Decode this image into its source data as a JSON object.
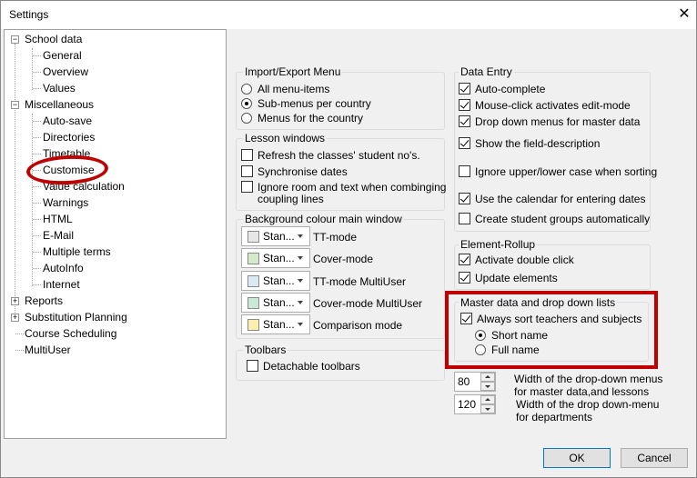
{
  "window": {
    "title": "Settings",
    "close_glyph": "✕"
  },
  "tree": {
    "school_data": {
      "label": "School data",
      "expanded": true,
      "children": [
        "General",
        "Overview",
        "Values"
      ]
    },
    "miscellaneous": {
      "label": "Miscellaneous",
      "expanded": true,
      "children": [
        "Auto-save",
        "Directories",
        "Timetable",
        "Customise",
        "Value calculation",
        "Warnings",
        "HTML",
        "E-Mail",
        "Multiple terms",
        "AutoInfo",
        "Internet"
      ]
    },
    "reports": {
      "label": "Reports"
    },
    "substitution": {
      "label": "Substitution Planning"
    },
    "course_scheduling": {
      "label": "Course Scheduling"
    },
    "multiuser": {
      "label": "MultiUser"
    },
    "highlighted_item": "Customise",
    "highlight_color": "#c00000"
  },
  "import_export": {
    "title": "Import/Export Menu",
    "options": [
      {
        "label": "All menu-items",
        "selected": false
      },
      {
        "label": "Sub-menus per country",
        "selected": true
      },
      {
        "label": "Menus for the country",
        "selected": false
      }
    ]
  },
  "lesson_windows": {
    "title": "Lesson windows",
    "items": [
      {
        "label": "Refresh the classes' student no's.",
        "checked": false
      },
      {
        "label": "Synchronise dates",
        "checked": false
      },
      {
        "label": "Ignore room and text when combinging",
        "label2": "coupling lines",
        "checked": false
      }
    ]
  },
  "background_colour": {
    "title": "Background colour main window",
    "items": [
      {
        "value": "Stan...",
        "label": "TT-mode",
        "swatch": "#e6e6e6"
      },
      {
        "value": "Stan...",
        "label": "Cover-mode",
        "swatch": "#d3ebc9"
      },
      {
        "value": "Stan...",
        "label": "TT-mode MultiUser",
        "swatch": "#dde8f5"
      },
      {
        "value": "Stan...",
        "label": "Cover-mode MultiUser",
        "swatch": "#c9e8d6"
      },
      {
        "value": "Stan...",
        "label": "Comparison mode",
        "swatch": "#fbefb0"
      }
    ]
  },
  "toolbars": {
    "title": "Toolbars",
    "items": [
      {
        "label": "Detachable toolbars",
        "checked": false
      }
    ]
  },
  "data_entry": {
    "title": "Data Entry",
    "items": [
      {
        "label": "Auto-complete",
        "checked": true
      },
      {
        "label": "Mouse-click activates edit-mode",
        "checked": true
      },
      {
        "label": "Drop down menus for master data",
        "checked": true
      },
      {
        "label": "Show the field-description",
        "checked": true
      },
      {
        "label": "Ignore upper/lower case when sorting",
        "checked": false
      },
      {
        "label": "Use the calendar for entering dates",
        "checked": true
      },
      {
        "label": "Create student groups automatically",
        "checked": false
      }
    ]
  },
  "element_rollup": {
    "title": "Element-Rollup",
    "items": [
      {
        "label": "Activate double click",
        "checked": true
      },
      {
        "label": "Update elements",
        "checked": true
      }
    ]
  },
  "master_data": {
    "title": "Master data and drop down lists",
    "sort": {
      "label": "Always sort teachers and subjects",
      "checked": true
    },
    "options": [
      {
        "label": "Short name",
        "selected": true
      },
      {
        "label": "Full name",
        "selected": false
      }
    ],
    "highlight_color": "#c00000"
  },
  "widths": {
    "masterdata": {
      "value": "80",
      "label1": "Width of the drop-down menus",
      "label2": "for master data,and lessons"
    },
    "departments": {
      "value": "120",
      "label1": "Width of the drop down-menu",
      "label2": "for departments"
    }
  },
  "buttons": {
    "ok": "OK",
    "cancel": "Cancel"
  }
}
